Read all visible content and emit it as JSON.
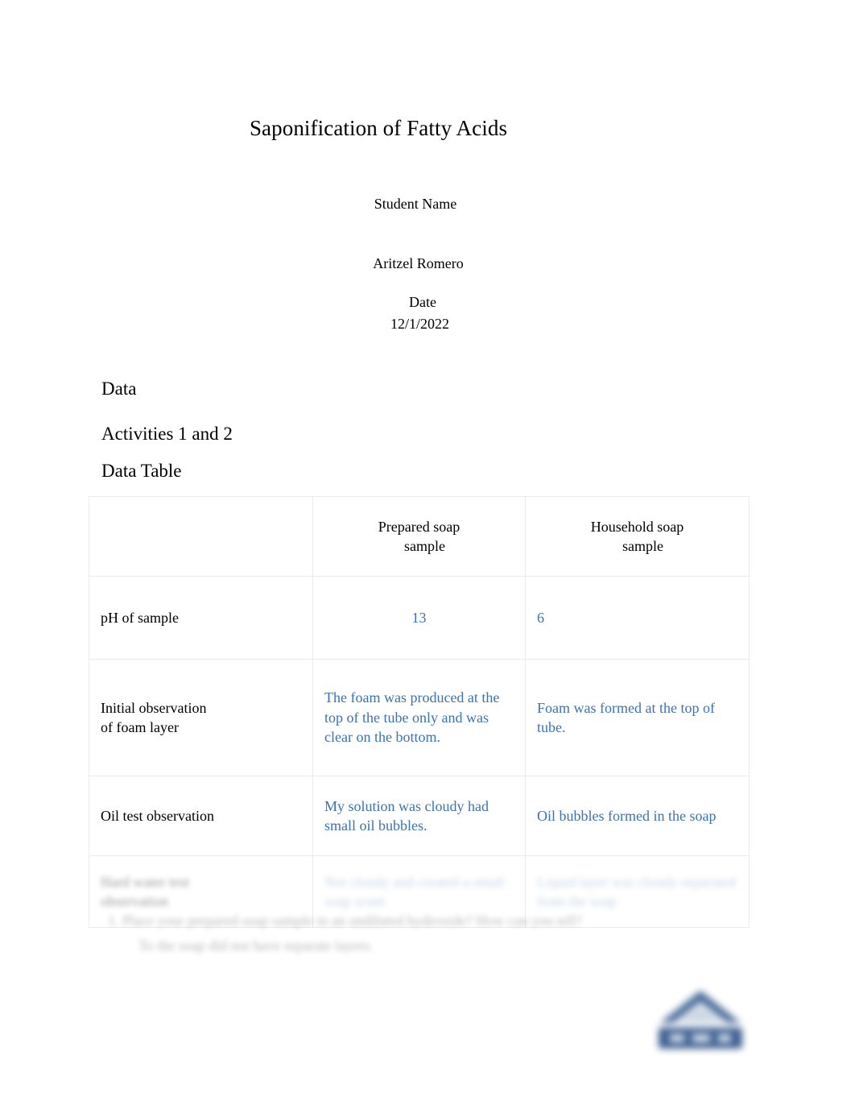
{
  "document": {
    "title": "Saponification of Fatty Acids",
    "student_label": "Student Name",
    "student_name": "Aritzel Romero",
    "date_label": "Date",
    "date_value": "12/1/2022"
  },
  "headings": {
    "data": "Data",
    "activities": "Activities 1 and 2",
    "data_table": "Data Table"
  },
  "table": {
    "columns": [
      "",
      "Prepared soap sample",
      "Household soap sample"
    ],
    "header": {
      "blank": "",
      "prepared_line1": "Prepared soap",
      "prepared_line2": "sample",
      "household_line1": "Household soap",
      "household_line2": "sample"
    },
    "rows": [
      {
        "label": "pH of sample",
        "prepared": "13",
        "household": "6"
      },
      {
        "label": "Initial observation of foam layer",
        "label_line1": "Initial observation",
        "label_line2": "of foam layer",
        "prepared": "The foam was produced at the top of the tube only and was clear on the bottom.",
        "household": "Foam was formed at the top of tube."
      },
      {
        "label": "Oil test observation",
        "prepared": "My solution was cloudy had small oil bubbles.",
        "household": "Oil bubbles formed in the soap"
      },
      {
        "label": "Hard water test observation",
        "label_line1": "Hard water test",
        "label_line2": "observation",
        "prepared": "Not cloudy and created a small soap scum",
        "household": "Liquid layer was cloudy separated from the soap"
      }
    ]
  },
  "questions": [
    {
      "number": "1.",
      "text": "Place your prepared soap sample in an undiluted hydroxide? How can you tell?",
      "answer": "To the soap did not have separate layers."
    }
  ],
  "colors": {
    "answer_blue": "#3b72b0",
    "table_border": "#ececec",
    "logo_blue": "#2e5288",
    "text_black": "#000000"
  },
  "logo": {
    "name": "institution-logo-watermark"
  }
}
